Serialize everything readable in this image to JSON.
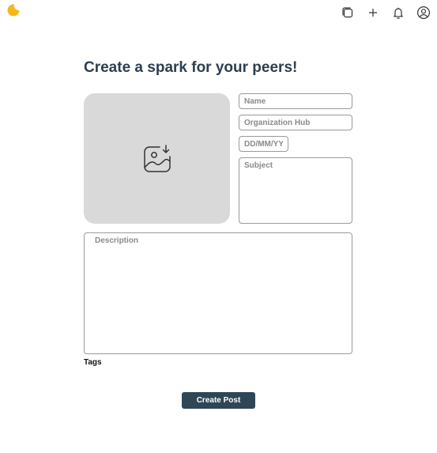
{
  "brand": {
    "logo_icon": "moon-logo-icon",
    "logo_color": "#f5b81c"
  },
  "topbar": {
    "icons": [
      "layers-icon",
      "plus-icon",
      "bell-icon",
      "user-circle-icon"
    ]
  },
  "form": {
    "title": "Create a spark for your peers!",
    "image_upload_icon": "image-download-icon",
    "name_placeholder": "Name",
    "organization_placeholder": "Organization Hub",
    "date_placeholder": "DD/MM/YY",
    "subject_placeholder": "Subject",
    "description_placeholder": "Description",
    "tags_label": "Tags",
    "submit_label": "Create Post"
  },
  "colors": {
    "title": "#2d3e4f",
    "button_bg": "#2f4656",
    "image_placeholder_bg": "#d9d9d9",
    "field_border": "#9a9a9a"
  }
}
